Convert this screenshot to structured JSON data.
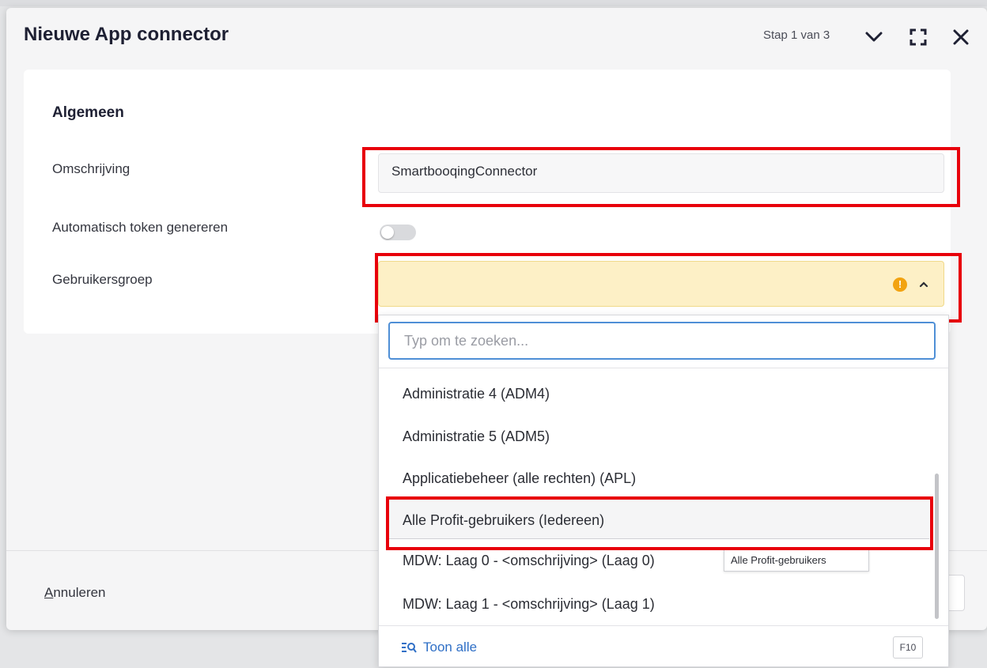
{
  "dialog": {
    "title": "Nieuwe App connector",
    "step": "Stap 1 van 3"
  },
  "section": {
    "title": "Algemeen",
    "description_label": "Omschrijving",
    "description_value": "SmartbooqingConnector",
    "token_label": "Automatisch token genereren",
    "token_enabled": false,
    "group_label": "Gebruikersgroep",
    "group_value": ""
  },
  "dropdown": {
    "search_placeholder": "Typ om te zoeken...",
    "items": [
      "Administratie 4 (ADM4)",
      "Administratie 5 (ADM5)",
      "Applicatiebeheer (alle rechten) (APL)",
      "Alle Profit-gebruikers (Iedereen)",
      "MDW: Laag 0 - <omschrijving> (Laag 0)",
      "MDW: Laag 1 - <omschrijving> (Laag 1)"
    ],
    "tooltip": "Alle Profit-gebruikers",
    "show_all": "Toon alle",
    "shortcut": "F10"
  },
  "footer": {
    "cancel_prefix": "A",
    "cancel_rest": "nnuleren"
  },
  "colors": {
    "highlight": "#e8000b",
    "warning": "#f2a311",
    "link": "#2f6fc6",
    "select_bg": "#fdf0c6"
  }
}
